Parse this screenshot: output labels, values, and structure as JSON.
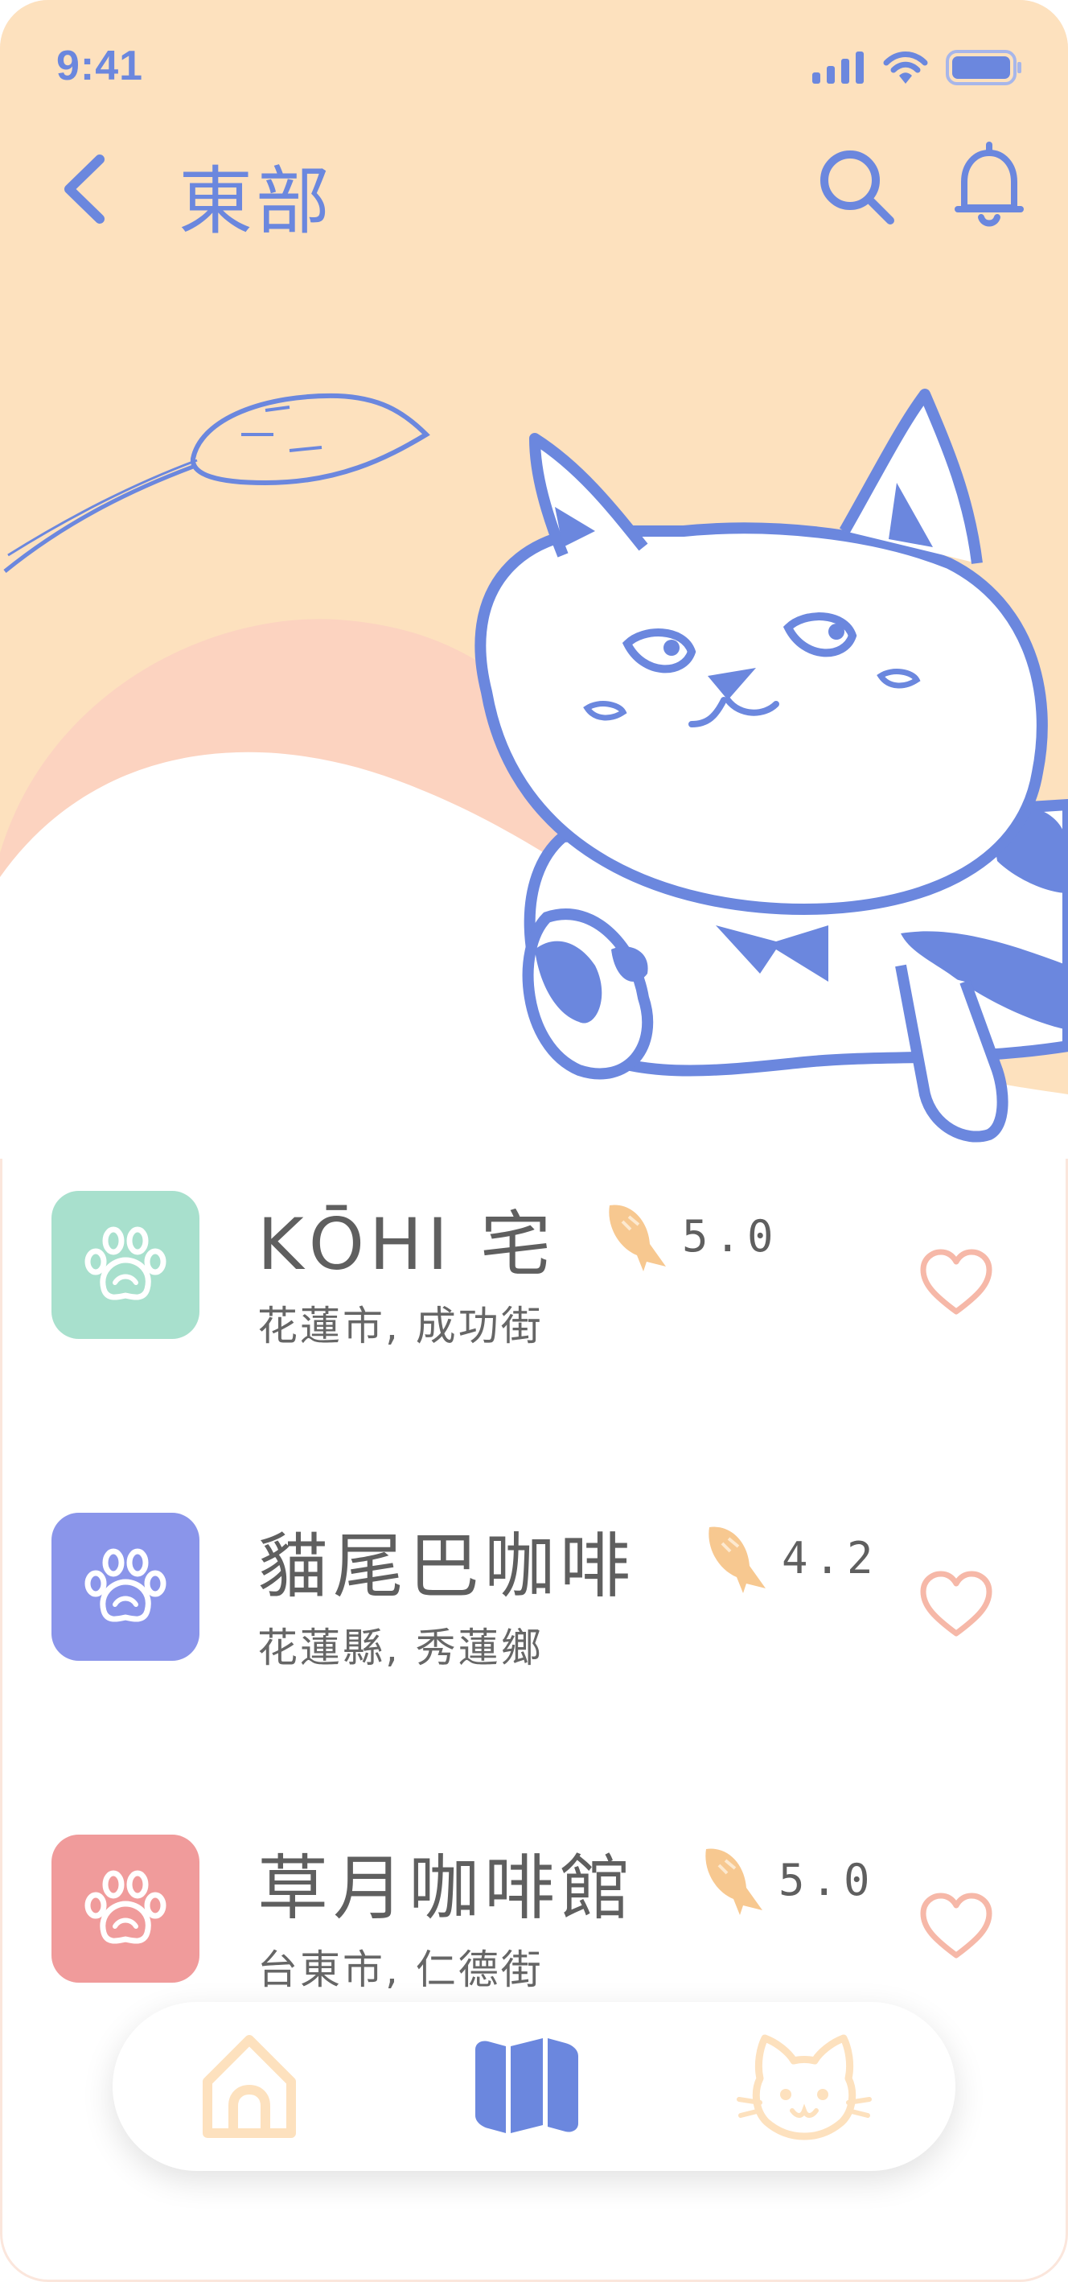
{
  "status_bar": {
    "time": "9:41"
  },
  "header": {
    "title": "東部"
  },
  "colors": {
    "hero_bg": "#fde1be",
    "accent_blue": "#6b87de",
    "heart": "#f6b8a8",
    "fish": "#f7c890"
  },
  "cafes": [
    {
      "name": "KŌHI 宅",
      "location": "花蓮市, 成功街",
      "rating": "5.0",
      "icon": "paw-icon",
      "color": "#a8e0cd"
    },
    {
      "name": "貓尾巴咖啡",
      "location": "花蓮縣, 秀蓮鄉",
      "rating": "4.2",
      "icon": "paw-icon",
      "color": "#8a95ea"
    },
    {
      "name": "草月咖啡館",
      "location": "台東市, 仁德街",
      "rating": "5.0",
      "icon": "paw-icon",
      "color": "#f09b9b"
    }
  ],
  "tabbar": {
    "items": [
      "home-icon",
      "map-icon",
      "cat-icon"
    ],
    "active": "map-icon"
  }
}
